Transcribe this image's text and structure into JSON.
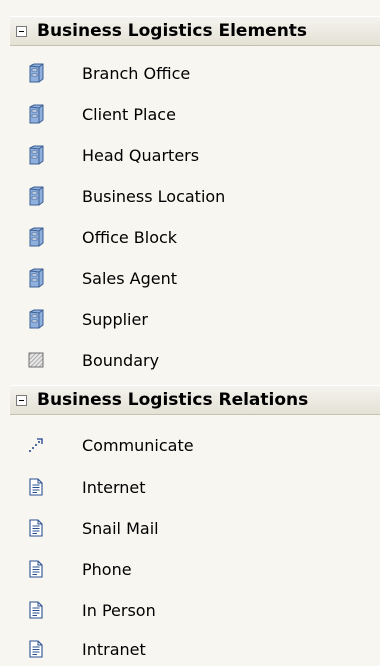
{
  "sections": [
    {
      "title": "Business Logistics Elements",
      "items": [
        {
          "label": "Branch Office",
          "icon": "building-icon"
        },
        {
          "label": "Client Place",
          "icon": "building-icon"
        },
        {
          "label": "Head Quarters",
          "icon": "building-icon"
        },
        {
          "label": "Business Location",
          "icon": "building-icon"
        },
        {
          "label": "Office Block",
          "icon": "building-icon"
        },
        {
          "label": "Sales Agent",
          "icon": "building-icon"
        },
        {
          "label": "Supplier",
          "icon": "building-icon"
        },
        {
          "label": "Boundary",
          "icon": "boundary-icon"
        }
      ]
    },
    {
      "title": "Business Logistics Relations",
      "items": [
        {
          "label": "Communicate",
          "icon": "dotted-arrow-icon"
        },
        {
          "label": "Internet",
          "icon": "document-icon"
        },
        {
          "label": "Snail Mail",
          "icon": "document-icon"
        },
        {
          "label": "Phone",
          "icon": "document-icon"
        },
        {
          "label": "In Person",
          "icon": "document-icon"
        },
        {
          "label": "Intranet",
          "icon": "document-icon"
        }
      ]
    }
  ],
  "colors": {
    "background": "#f7f6f0",
    "header_gradient_top": "#f4f3ee",
    "header_gradient_bottom": "#e4e2d5",
    "building_icon": "#5a7fb5"
  }
}
